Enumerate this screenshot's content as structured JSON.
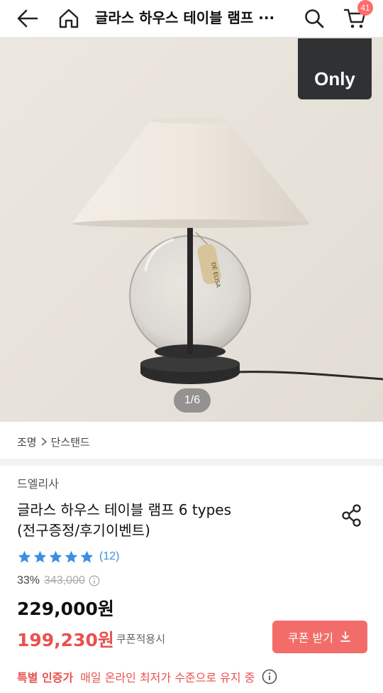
{
  "header": {
    "title": "글라스 하우스 테이블 램프 ···",
    "cart_count": "41"
  },
  "hero": {
    "badge_text": "Only",
    "tag_text": "DE ELISA",
    "counter": "1/6"
  },
  "breadcrumb": [
    "조명",
    "단스탠드"
  ],
  "product": {
    "brand": "드엘리사",
    "title_line1": "글라스 하우스 테이블 램프 6 types",
    "title_line2": "(전구증정/후기이벤트)",
    "rating_stars": 5,
    "review_count": "(12)",
    "discount_rate": "33%",
    "original_price": "343,000",
    "sale_price": "229,000원",
    "coupon_price": "199,230원",
    "coupon_note": "쿠폰적용시",
    "coupon_button": "쿠폰 받기",
    "special_label": "특별 인증가",
    "special_text": "매일 온라인 최저가 수준으로 유지 중"
  },
  "colors": {
    "accent_red": "#e8524f",
    "coupon_button": "#f26d6a",
    "star_blue": "#3d8ee0",
    "cart_badge": "#ff6b6b"
  }
}
